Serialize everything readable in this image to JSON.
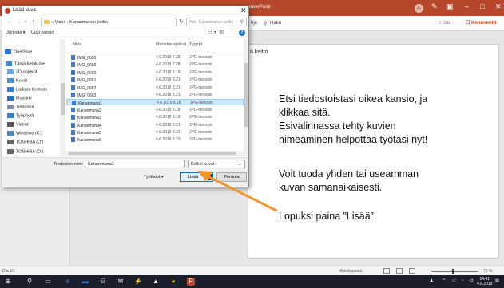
{
  "powerpoint": {
    "title_fragment": "owerPoint",
    "avatar": "JL",
    "ribbon_tabs": [
      "hje",
      "Haku"
    ],
    "share": "Jaa",
    "comments": "Kommentit",
    "slide_text_fragment": "n keitto",
    "status_slide": "Dia 1/1",
    "status_notes": "Muistiinpanot",
    "zoom": "75 %"
  },
  "dialog": {
    "title": "Lisää kuva",
    "path": "« Vates › Kananmunan-keitto",
    "search_placeholder": "Hae: Kananmunan-keitto",
    "organize": "Järjestä ▾",
    "new_folder": "Uusi kansio",
    "nav_items": [
      {
        "label": "OneDrive",
        "icon": "cloud-icon",
        "color": "#1e73d6"
      },
      {
        "label": "Tämä tietokone",
        "icon": "computer-icon",
        "color": "#3c8fd9"
      },
      {
        "label": "3D-objektit",
        "icon": "cube-icon",
        "color": "#6aa7e8"
      },
      {
        "label": "Kuvat",
        "icon": "pictures-icon",
        "color": "#4b8fd6"
      },
      {
        "label": "Ladatut tiedosto",
        "icon": "download-icon",
        "color": "#2a7fe0"
      },
      {
        "label": "Musiikki",
        "icon": "music-icon",
        "color": "#2a6fd0"
      },
      {
        "label": "Tiedostot",
        "icon": "documents-icon",
        "color": "#7c8ea6"
      },
      {
        "label": "Työpöytä",
        "icon": "desktop-icon",
        "color": "#2f7fd3"
      },
      {
        "label": "Videot",
        "icon": "video-icon",
        "color": "#555555"
      },
      {
        "label": "Windows (C:)",
        "icon": "drive-icon",
        "color": "#4a86c8"
      },
      {
        "label": "TOSHIBA (D:)",
        "icon": "usb-drive-icon",
        "color": "#666666"
      },
      {
        "label": "TOSHIBA (D:)",
        "icon": "usb-drive-icon",
        "color": "#666666"
      }
    ],
    "columns": {
      "name": "Nimi",
      "date": "Muokkauspäivä",
      "type": "Tyyppi"
    },
    "files": [
      {
        "name": "IMG_0655",
        "date": "4.6.2019 7.28",
        "type": "JPG-tiedosto"
      },
      {
        "name": "IMG_0656",
        "date": "4.6.2019 7.28",
        "type": "JPG-tiedosto"
      },
      {
        "name": "IMG_0660",
        "date": "4.6.2019 8.19",
        "type": "JPG-tiedosto"
      },
      {
        "name": "IMG_0661",
        "date": "4.6.2019 8.21",
        "type": "JPG-tiedosto"
      },
      {
        "name": "IMG_0662",
        "date": "4.6.2019 8.21",
        "type": "JPG-tiedosto"
      },
      {
        "name": "IMG_0663",
        "date": "4.6.2019 8.21",
        "type": "JPG-tiedosto"
      },
      {
        "name": "Kananmuna1",
        "date": "4.6.2019 8.18",
        "type": "JPG-tiedosto"
      },
      {
        "name": "Kananmuna2",
        "date": "4.6.2019 8.18",
        "type": "JPG-tiedosto"
      },
      {
        "name": "Kananmuna3",
        "date": "4.6.2019 8.19",
        "type": "JPG-tiedosto"
      },
      {
        "name": "Kananmuna4",
        "date": "4.6.2019 8.21",
        "type": "JPG-tiedosto"
      },
      {
        "name": "Kananmuna5",
        "date": "4.6.2019 8.21",
        "type": "JPG-tiedosto"
      },
      {
        "name": "Kananmuna6",
        "date": "4.6.2019 8.23",
        "type": "JPG-tiedosto"
      }
    ],
    "selected_index": 6,
    "filename_label": "Tiedoston nimi:",
    "filename_value": "Kananmuna1",
    "filetype": "Kaikki kuvat",
    "tools": "Työkalut ▾",
    "add": "Lisää",
    "cancel": "Peruuta"
  },
  "annotations": {
    "line1": "Etsi tiedostoistasi oikea kansio, ja",
    "line2": "klikkaa sitä.",
    "line3": "Esivalinnassa tehty kuvien",
    "line4": "nimeäminen helpottaa työtäsi nyt!",
    "line5": "Voit tuoda yhden tai useamman",
    "line6": "kuvan samanaikaisesti.",
    "line7": "Lopuksi paina ”Lisää”.",
    "arrow_color": "#f0962d"
  },
  "taskbar": {
    "time": "14.41",
    "date": "4.6.2019"
  }
}
